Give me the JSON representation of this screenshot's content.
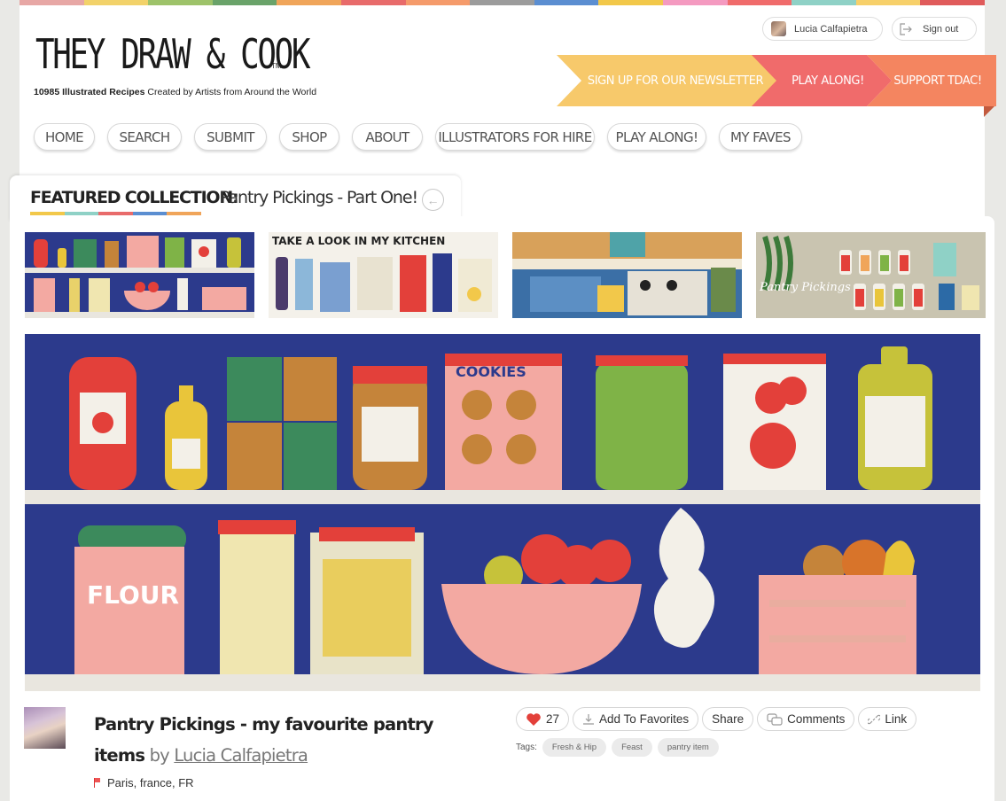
{
  "site": {
    "logo_text": "THEY DRAW & COOK",
    "logo_tm": "TM",
    "tagline_bold": "10985 Illustrated Recipes",
    "tagline_rest": " Created by Artists from Around the World",
    "rainbow_colors": [
      "#e7a7a5",
      "#f2d26a",
      "#9ec36a",
      "#6aa36a",
      "#f0a55a",
      "#e86b6b",
      "#f59b6b",
      "#9c9c9c",
      "#5b8ed1",
      "#f2c84a",
      "#f49ac0",
      "#f06b6b",
      "#8fd1c6",
      "#f7d06a",
      "#e05b5b"
    ]
  },
  "user": {
    "name": "Lucia Calfapietra",
    "signout_label": "Sign out"
  },
  "ribbons": {
    "newsletter": "SIGN UP FOR OUR NEWSLETTER",
    "play_along": "PLAY ALONG!",
    "support": "SUPPORT TDAC!"
  },
  "nav": {
    "items": [
      "HOME",
      "SEARCH",
      "SUBMIT",
      "SHOP",
      "ABOUT",
      "ILLUSTRATORS FOR HIRE",
      "PLAY ALONG!",
      "MY FAVES"
    ]
  },
  "featured": {
    "label": "FEATURED COLLECTION:",
    "title": "Pantry Pickings - Part One!",
    "underline_colors": [
      "#f2c84a",
      "#8fd1c6",
      "#e86b6b",
      "#5b8ed1",
      "#f0a55a"
    ]
  },
  "thumbnails": [
    {
      "name": "pantry-shelves-thumb"
    },
    {
      "name": "take-a-look-in-my-kitchen-thumb",
      "caption": "TAKE A LOOK IN MY KITCHEN"
    },
    {
      "name": "kitchen-scene-thumb"
    },
    {
      "name": "pantry-pickings-jars-thumb",
      "caption": "Pantry Pickings"
    }
  ],
  "post": {
    "title": "Pantry Pickings - my favourite pantry items",
    "by": "by",
    "author": "Lucia Calfapietra",
    "location": "Paris, france, FR",
    "like_count": "27",
    "add_favorites_label": "Add To Favorites",
    "share_label": "Share",
    "comments_label": "Comments",
    "link_label": "Link",
    "tags_label": "Tags:",
    "tags": [
      "Fresh & Hip",
      "Feast",
      "pantry item"
    ]
  },
  "hero": {
    "cookies_label": "COOKIES",
    "flour_label": "FLOUR"
  },
  "colors": {
    "navy": "#2c3a8c",
    "shelf": "#e9e6df",
    "red": "#e3403a",
    "pink": "#f3a9a2",
    "mustard": "#e9c53a",
    "green": "#7fb347",
    "newsletter": "#f7c96b",
    "play_along": "#f06b6b",
    "support": "#f48560"
  }
}
